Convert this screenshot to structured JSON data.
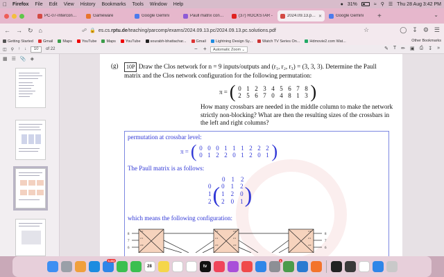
{
  "menubar": {
    "app": "Firefox",
    "items": [
      "File",
      "Edit",
      "View",
      "History",
      "Bookmarks",
      "Tools",
      "Window",
      "Help"
    ],
    "battery": "31%",
    "datetime": "Thu 28 Aug  3:42 PM"
  },
  "tabs": [
    {
      "title": "PC-07-Interconnect.k",
      "color": "#d34a44"
    },
    {
      "title": "Gameware",
      "color": "#e8742c"
    },
    {
      "title": "Google Gemini",
      "color": "#4b7bec"
    },
    {
      "title": "Paull matrix construc",
      "color": "#8e5bd6"
    },
    {
      "title": "(37) ROCKSTAR -",
      "color": "#e02020"
    },
    {
      "title": "2024.09.13.pc.soluti",
      "color": "#d34a44"
    },
    {
      "title": "Google Gemini",
      "color": "#4b7bec"
    }
  ],
  "active_tab_index": 5,
  "url": {
    "prefix": "es.cs.",
    "domain": "rptu.de",
    "path": "/teaching/parcomp/exams/2024.09.13.pc/2024.09.13.pc.solutions.pdf"
  },
  "bookmarks": [
    {
      "label": "Getting Started",
      "color": "#555"
    },
    {
      "label": "Gmail",
      "color": "#d33"
    },
    {
      "label": "Maps",
      "color": "#3a9d4a"
    },
    {
      "label": "YouTube",
      "color": "#e00"
    },
    {
      "label": "Maps",
      "color": "#3a9d4a"
    },
    {
      "label": "YouTube",
      "color": "#e00"
    },
    {
      "label": "sourabh-bhattachar...",
      "color": "#222"
    },
    {
      "label": "Gmail",
      "color": "#d33"
    },
    {
      "label": "Lightning Design Sy...",
      "color": "#1d8ce0"
    },
    {
      "label": "Watch TV Series On...",
      "color": "#c33"
    },
    {
      "label": "Hdmovie2.com Wat...",
      "color": "#2a6"
    }
  ],
  "other_bookmarks": "Other Bookmarks",
  "pdf": {
    "page_current": "10",
    "page_total": "of 22",
    "zoom": "Automatic Zoom"
  },
  "question": {
    "label": "(g)",
    "points": "10P",
    "text": "Draw the Clos network for n = 9 inputs/outputs and (r₁, r₂, r₃) = (3, 3, 3). Determine the Paull matrix and the Clos network configuration for the following permutation:",
    "pi": "π =",
    "perm_row1": [
      "0",
      "1",
      "2",
      "3",
      "4",
      "5",
      "6",
      "7",
      "8"
    ],
    "perm_row2": [
      "2",
      "5",
      "6",
      "7",
      "0",
      "4",
      "8",
      "1",
      "3"
    ],
    "text2": "How many crossbars are needed in the middle column to make the network strictly non-blocking? What are then the resulting sizes of the crossbars in the left and right columns?"
  },
  "solution": {
    "perm_heading": "permutation at crossbar level:",
    "pi": "π =",
    "cb_row1": [
      "0",
      "0",
      "0",
      "1",
      "1",
      "1",
      "2",
      "2",
      "2"
    ],
    "cb_row2": [
      "0",
      "1",
      "2",
      "2",
      "0",
      "1",
      "2",
      "0",
      "1"
    ],
    "paull_heading": "The Paull matrix is as follows:",
    "paull_cols": [
      "0",
      "1",
      "2"
    ],
    "paull_rows": [
      {
        "label": "0",
        "cells": [
          "0",
          "1",
          "2"
        ]
      },
      {
        "label": "1",
        "cells": [
          "1",
          "2",
          "0"
        ]
      },
      {
        "label": "2",
        "cells": [
          "2",
          "0",
          "1"
        ]
      }
    ],
    "config_heading": "which means the following configuration:",
    "clos_left_labels": [
      "8",
      "7",
      "6"
    ],
    "clos_right_labels": [
      "8",
      "7",
      "6"
    ],
    "clos_port_labels_left": [
      "2.2",
      "2.1",
      "2.0"
    ],
    "clos_port_labels_mid_in": [
      "2.2",
      "2.1",
      "2.0"
    ],
    "clos_port_labels_mid_out": [
      "2.2",
      "2.1",
      "2.0"
    ],
    "clos_port_labels_right": [
      "2.2",
      "2.1",
      "2.0"
    ]
  },
  "dock": [
    {
      "name": "finder",
      "color": "#3d8ff2"
    },
    {
      "name": "launchpad",
      "color": "#9aa0a8"
    },
    {
      "name": "photos",
      "color": "#f0a03c"
    },
    {
      "name": "safari",
      "color": "#1d8ce0"
    },
    {
      "name": "mail",
      "color": "#2f86e8",
      "badge": "3,442"
    },
    {
      "name": "facetime",
      "color": "#3bbf4f"
    },
    {
      "name": "messages",
      "color": "#3bbf4f"
    },
    {
      "name": "calendar",
      "color": "#ffffff",
      "text": "28"
    },
    {
      "name": "notes",
      "color": "#f5d64a"
    },
    {
      "name": "reminders",
      "color": "#ffffff"
    },
    {
      "name": "freeform",
      "color": "#ffffff"
    },
    {
      "name": "tv",
      "color": "#111111",
      "text": "tv"
    },
    {
      "name": "music",
      "color": "#f0445a"
    },
    {
      "name": "podcasts",
      "color": "#a94fd9"
    },
    {
      "name": "news",
      "color": "#f04a4a"
    },
    {
      "name": "app-store",
      "color": "#2f86e8"
    },
    {
      "name": "settings",
      "color": "#8d8f95",
      "badge": "1"
    },
    {
      "name": "chrome",
      "color": "#4b9b4b"
    },
    {
      "name": "vscode",
      "color": "#2a7ad1"
    },
    {
      "name": "firefox",
      "color": "#f3742c"
    },
    {
      "name": "terminal",
      "color": "#222222"
    },
    {
      "name": "activity-monitor",
      "color": "#3a3a3a"
    },
    {
      "name": "preview",
      "color": "#ffffff"
    },
    {
      "name": "downloads",
      "color": "#2f86e8"
    },
    {
      "name": "trash",
      "color": "#c9c9c9"
    }
  ]
}
